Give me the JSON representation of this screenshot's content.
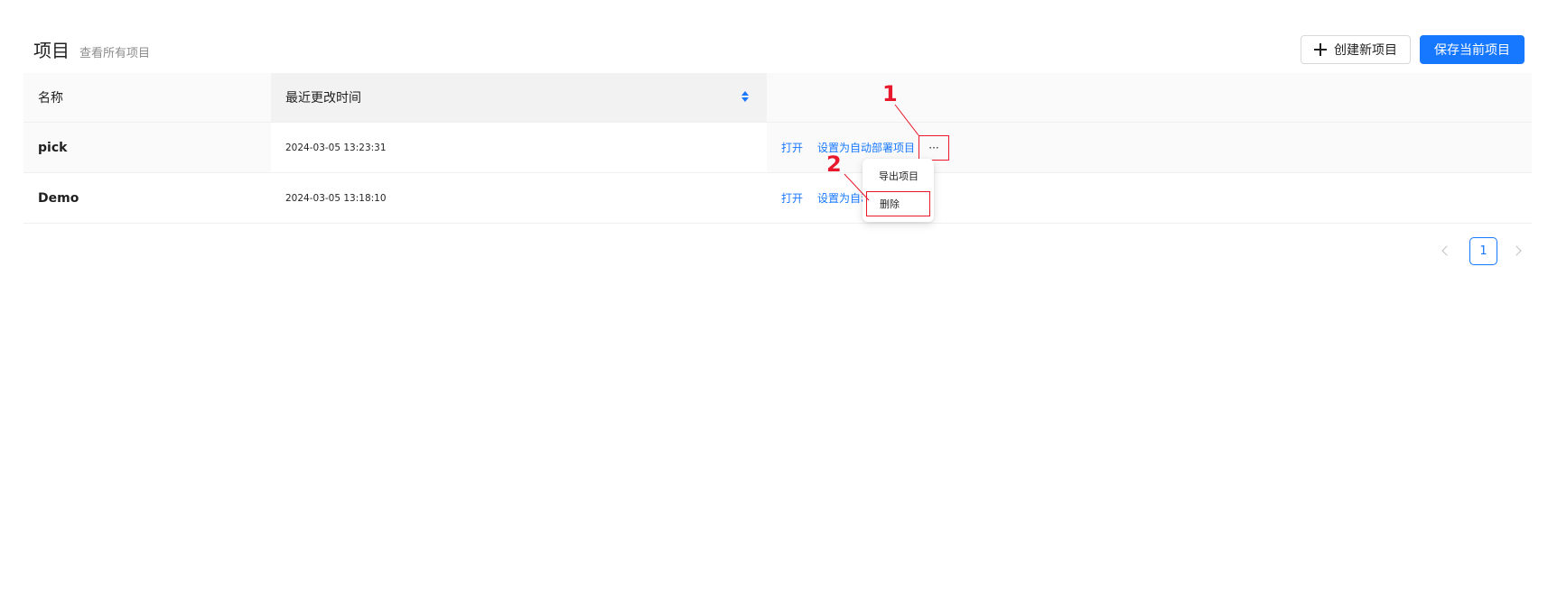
{
  "header": {
    "title": "项目",
    "subtitle": "查看所有项目",
    "create_button": "创建新项目",
    "save_button": "保存当前项目"
  },
  "table": {
    "columns": [
      "名称",
      "最近更改时间",
      ""
    ],
    "rows": [
      {
        "name": "pick",
        "modified": "2024-03-05 13:23:31",
        "actions": {
          "open": "打开",
          "set_auto_deploy": "设置为自动部署项目",
          "more": "···"
        }
      },
      {
        "name": "Demo",
        "modified": "2024-03-05 13:18:10",
        "actions": {
          "open": "打开",
          "set_auto_deploy": "设置为自动"
        }
      }
    ]
  },
  "dropdown": {
    "items": [
      "导出项目",
      "删除"
    ]
  },
  "pagination": {
    "current_page": "1"
  },
  "annotations": {
    "step1": "1",
    "step2": "2"
  },
  "colors": {
    "primary": "#1677ff",
    "annotation": "#e8192c"
  },
  "icons": [
    "plus-icon",
    "sort-icon",
    "chevron-left-icon",
    "chevron-right-icon",
    "more-icon"
  ]
}
